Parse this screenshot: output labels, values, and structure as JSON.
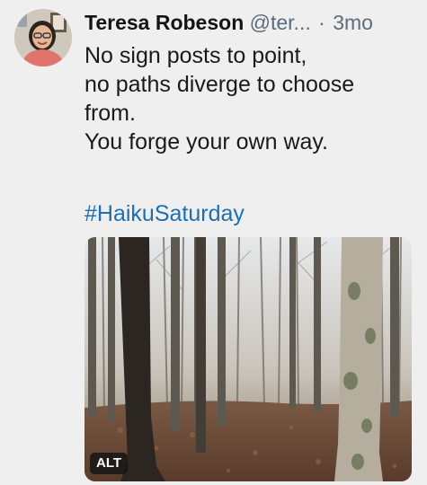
{
  "post": {
    "author_name": "Teresa Robeson",
    "handle": "@ter...",
    "separator": "·",
    "age": "3mo",
    "lines": [
      "No sign posts to point,",
      "no paths diverge to choose",
      "from.",
      "You forge your own way."
    ],
    "hashtag": "#HaikuSaturday",
    "media": {
      "alt_badge": "ALT"
    }
  },
  "colors": {
    "background": "#efeff0",
    "link": "#1d6fb0",
    "muted": "#5b6c7b"
  },
  "icons": {
    "avatar": "profile-photo",
    "media": "forest-photo"
  }
}
